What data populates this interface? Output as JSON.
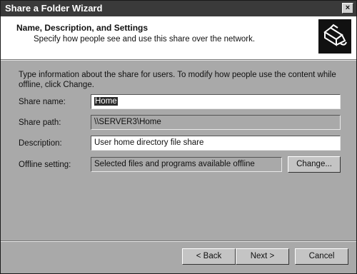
{
  "window": {
    "title": "Share a Folder Wizard",
    "close_glyph": "×"
  },
  "header": {
    "title": "Name, Description, and Settings",
    "subtitle": "Specify how people see and use this share over the network.",
    "icon": "folder-share-icon"
  },
  "intro": "Type information about the share for users. To modify how people use the content while offline, click Change.",
  "form": {
    "share_name": {
      "label": "Share name:",
      "value": "Home"
    },
    "share_path": {
      "label": "Share path:",
      "value": "\\\\SERVER3\\Home"
    },
    "description": {
      "label": "Description:",
      "value": "User home directory file share"
    },
    "offline_setting": {
      "label": "Offline setting:",
      "value": "Selected files and programs available offline"
    },
    "change_label": "Change..."
  },
  "buttons": {
    "back": "< Back",
    "next": "Next >",
    "cancel": "Cancel"
  }
}
